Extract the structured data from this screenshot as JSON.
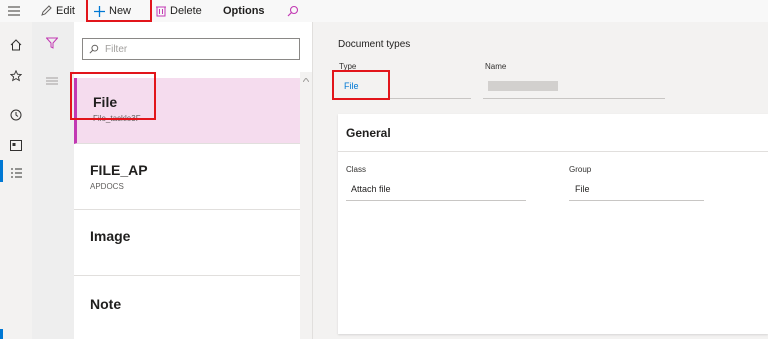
{
  "toolbar": {
    "menu_icon": "hamburger-icon",
    "edit_label": "Edit",
    "new_label": "New",
    "delete_label": "Delete",
    "options_label": "Options",
    "search_icon": "search-icon"
  },
  "nav": {
    "icons": [
      "home-icon",
      "star-icon",
      "clock-icon",
      "workspace-icon",
      "list-icon"
    ]
  },
  "list": {
    "filter_placeholder": "Filter",
    "items": [
      {
        "title": "File",
        "subtitle": "File_tackle3F",
        "selected": true
      },
      {
        "title": "FILE_AP",
        "subtitle": "APDOCS",
        "selected": false
      },
      {
        "title": "Image",
        "subtitle": "",
        "selected": false
      },
      {
        "title": "Note",
        "subtitle": "",
        "selected": false
      }
    ]
  },
  "detail": {
    "caption": "Document types",
    "type_label": "Type",
    "type_value": "File",
    "name_label": "Name",
    "name_value": "",
    "section_title": "General",
    "class_label": "Class",
    "class_value": "Attach file",
    "group_label": "Group",
    "group_value": "File"
  },
  "colors": {
    "accent": "#c239b3",
    "highlight_box": "#e2151b",
    "link": "#0078d4"
  }
}
